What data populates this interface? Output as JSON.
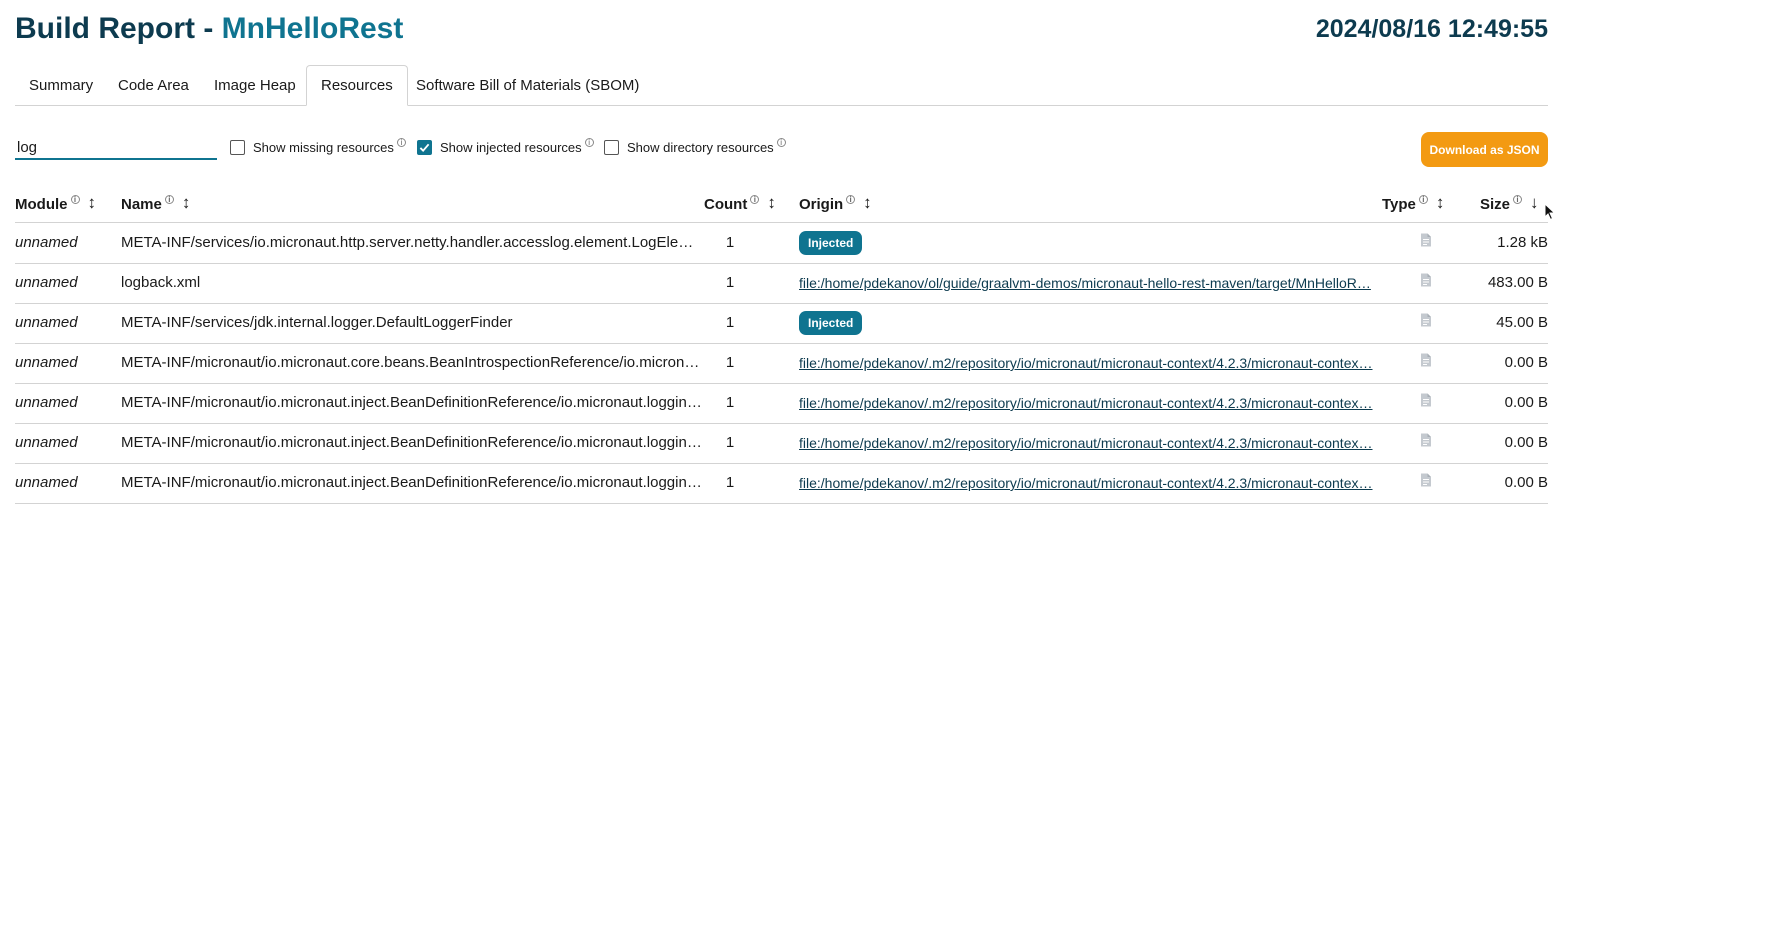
{
  "header": {
    "title_prefix": "Build Report - ",
    "app_name": "MnHelloRest",
    "timestamp": "2024/08/16 12:49:55"
  },
  "tabs": [
    {
      "label": "Summary",
      "active": false
    },
    {
      "label": "Code Area",
      "active": false
    },
    {
      "label": "Image Heap",
      "active": false
    },
    {
      "label": "Resources",
      "active": true
    },
    {
      "label": "Software Bill of Materials (SBOM)",
      "active": false
    }
  ],
  "filters": {
    "search_value": "log",
    "show_missing": {
      "label": "Show missing resources",
      "checked": false
    },
    "show_injected": {
      "label": "Show injected resources",
      "checked": true
    },
    "show_directory": {
      "label": "Show directory resources",
      "checked": false
    },
    "download_label": "Download as JSON"
  },
  "table": {
    "columns": {
      "module": "Module",
      "name": "Name",
      "count": "Count",
      "origin": "Origin",
      "type": "Type",
      "size": "Size"
    },
    "sort_icon": "↕",
    "sort_active_icon": "↓",
    "rows": [
      {
        "module": "unnamed",
        "name": "META-INF/services/io.micronaut.http.server.netty.handler.accesslog.element.LogElementB…",
        "count": "1",
        "origin": "Injected",
        "origin_type": "badge",
        "size": "1.28 kB"
      },
      {
        "module": "unnamed",
        "name": "logback.xml",
        "count": "1",
        "origin": "file:/home/pdekanov/ol/guide/graalvm-demos/micronaut-hello-rest-maven/target/MnHelloR…",
        "origin_type": "link",
        "size": "483.00 B"
      },
      {
        "module": "unnamed",
        "name": "META-INF/services/jdk.internal.logger.DefaultLoggerFinder",
        "count": "1",
        "origin": "Injected",
        "origin_type": "badge",
        "size": "45.00 B"
      },
      {
        "module": "unnamed",
        "name": "META-INF/micronaut/io.micronaut.core.beans.BeanIntrospectionReference/io.micronaut.lo…",
        "count": "1",
        "origin": "file:/home/pdekanov/.m2/repository/io/micronaut/micronaut-context/4.2.3/micronaut-contex…",
        "origin_type": "link",
        "size": "0.00 B"
      },
      {
        "module": "unnamed",
        "name": "META-INF/micronaut/io.micronaut.inject.BeanDefinitionReference/io.micronaut.logging.$P…",
        "count": "1",
        "origin": "file:/home/pdekanov/.m2/repository/io/micronaut/micronaut-context/4.2.3/micronaut-contex…",
        "origin_type": "link",
        "size": "0.00 B"
      },
      {
        "module": "unnamed",
        "name": "META-INF/micronaut/io.micronaut.inject.BeanDefinitionReference/io.micronaut.logging.im…",
        "count": "1",
        "origin": "file:/home/pdekanov/.m2/repository/io/micronaut/micronaut-context/4.2.3/micronaut-contex…",
        "origin_type": "link",
        "size": "0.00 B"
      },
      {
        "module": "unnamed",
        "name": "META-INF/micronaut/io.micronaut.inject.BeanDefinitionReference/io.micronaut.logging.im…",
        "count": "1",
        "origin": "file:/home/pdekanov/.m2/repository/io/micronaut/micronaut-context/4.2.3/micronaut-contex…",
        "origin_type": "link",
        "size": "0.00 B"
      }
    ]
  },
  "colors": {
    "accent": "#0f7490",
    "title": "#0d3b4f",
    "button": "#f39a12"
  },
  "icons": {
    "info": "info-icon",
    "file": "file-icon",
    "sort": "sort-icon",
    "cursor": "mouse-cursor-icon"
  }
}
